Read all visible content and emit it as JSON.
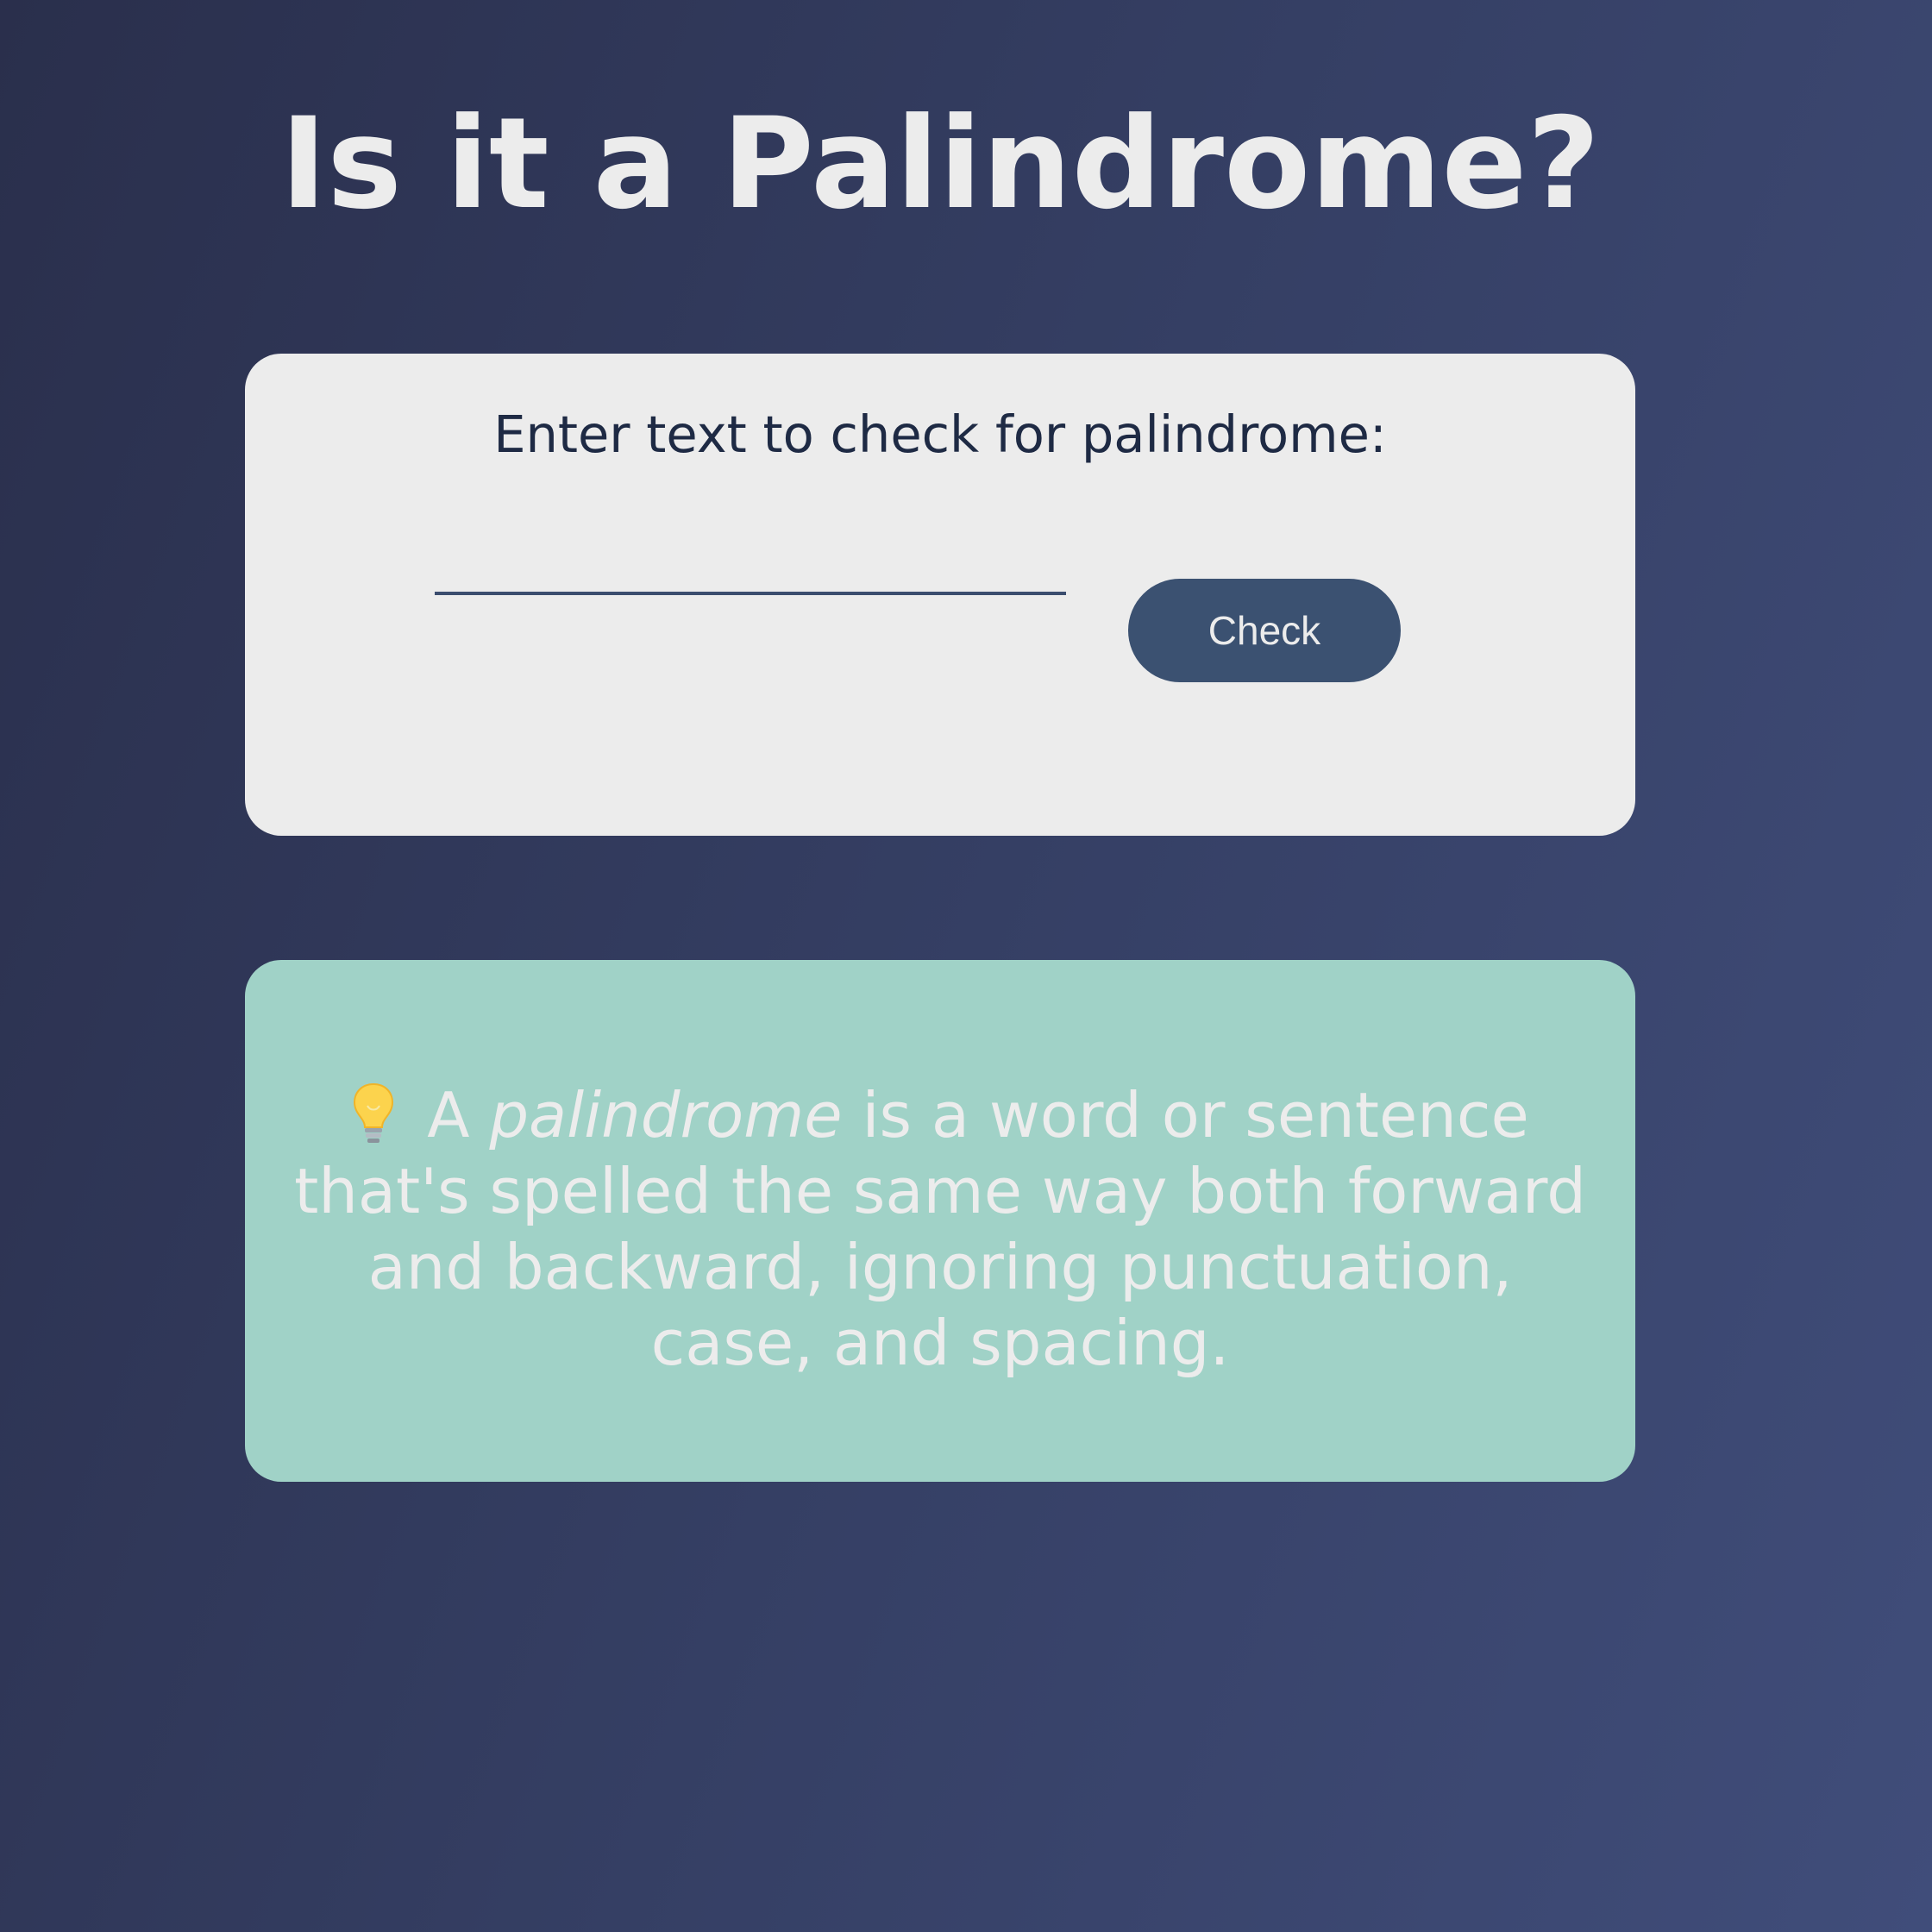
{
  "page": {
    "title": "Is it a Palindrome?"
  },
  "checker": {
    "label": "Enter text to check for palindrome:",
    "input_value": "",
    "check_label": "Check"
  },
  "info": {
    "icon": "lightbulb-icon",
    "intro": "A ",
    "term": "palindrome",
    "definition": " is a word or sentence that's spelled the same way both forward and backward, ignoring punctuation, case, and spacing."
  },
  "colors": {
    "background_start": "#2a2f4c",
    "background_end": "#404d7a",
    "card": "#ececec",
    "button": "#3b5171",
    "info_card": "#a0d2c7",
    "text_light": "#ececec",
    "text_dark": "#1e2a44"
  }
}
